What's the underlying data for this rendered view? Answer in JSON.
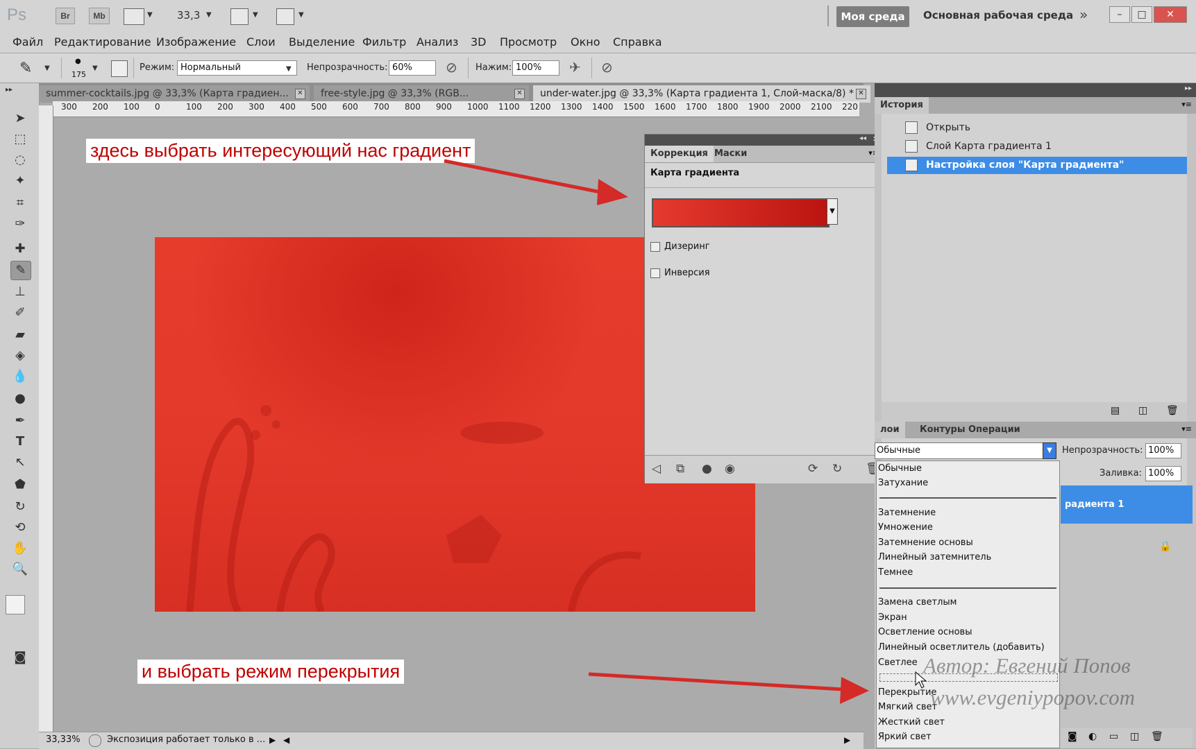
{
  "app": {
    "logo": "Ps",
    "zoom": "33,3",
    "bridge": "Br",
    "minibridge": "Mb"
  },
  "workspace": {
    "active": "Моя среда",
    "main": "Основная рабочая среда",
    "more": "»"
  },
  "menu": [
    "Файл",
    "Редактирование",
    "Изображение",
    "Слои",
    "Выделение",
    "Фильтр",
    "Анализ",
    "3D",
    "Просмотр",
    "Окно",
    "Справка"
  ],
  "options": {
    "brush_size": "175",
    "mode_label": "Режим:",
    "mode_value": "Нормальный",
    "opacity_label": "Непрозрачность:",
    "opacity_value": "60%",
    "pressure_label": "Нажим:",
    "pressure_value": "100%"
  },
  "tabs": [
    {
      "label": "summer-cocktails.jpg @ 33,3% (Карта градиен..."
    },
    {
      "label": "free-style.jpg @ 33,3% (RGB..."
    },
    {
      "label": "under-water.jpg @ 33,3% (Карта градиента 1, Слой-маска/8) *"
    }
  ],
  "ruler": [
    "300",
    "200",
    "100",
    "0",
    "100",
    "200",
    "300",
    "400",
    "500",
    "600",
    "700",
    "800",
    "900",
    "1000",
    "1100",
    "1200",
    "1300",
    "1400",
    "1500",
    "1600",
    "1700",
    "1800",
    "1900",
    "2000",
    "2100",
    "220"
  ],
  "annotations": {
    "top": "здесь выбрать интересующий нас градиент",
    "bottom": "и выбрать режим перекрытия"
  },
  "status": {
    "zoom": "33,33%",
    "message": "Экспозиция работает только в ..."
  },
  "adjustments": {
    "tab1": "Коррекция",
    "tab2": "Маски",
    "title": "Карта градиента",
    "dither": "Дизеринг",
    "inverse": "Инверсия"
  },
  "history": {
    "title": "История",
    "items": [
      {
        "label": "Открыть"
      },
      {
        "label": "Слой Карта градиента 1"
      },
      {
        "label": "Настройка слоя \"Карта градиента\""
      }
    ]
  },
  "layers": {
    "tab1": "лои",
    "tab2": "Контуры",
    "tab3": "Операции",
    "blend_value": "Обычные",
    "opacity_label": "Непрозрачность:",
    "opacity_value": "100%",
    "fill_label": "Заливка:",
    "fill_value": "100%",
    "selected_layer": "радиента 1"
  },
  "blend_modes": {
    "group1": [
      "Обычные",
      "Затухание"
    ],
    "group2": [
      "Затемнение",
      "Умножение",
      "Затемнение основы",
      "Линейный затемнитель",
      "Темнее"
    ],
    "group3": [
      "Замена светлым",
      "Экран",
      "Осветление основы",
      "Линейный осветлитель (добавить)",
      "Светлее"
    ],
    "group4": [
      "Перекрытие",
      "Мягкий свет",
      "Жесткий свет",
      "Яркий свет"
    ]
  },
  "watermark": {
    "line1": "Автор: Евгений Попов",
    "line2": "www.evgeniypopov.com"
  },
  "colors": {
    "accent_selection": "#3d8de6",
    "arrow": "#d42a28",
    "annotation_text": "#c00000"
  }
}
